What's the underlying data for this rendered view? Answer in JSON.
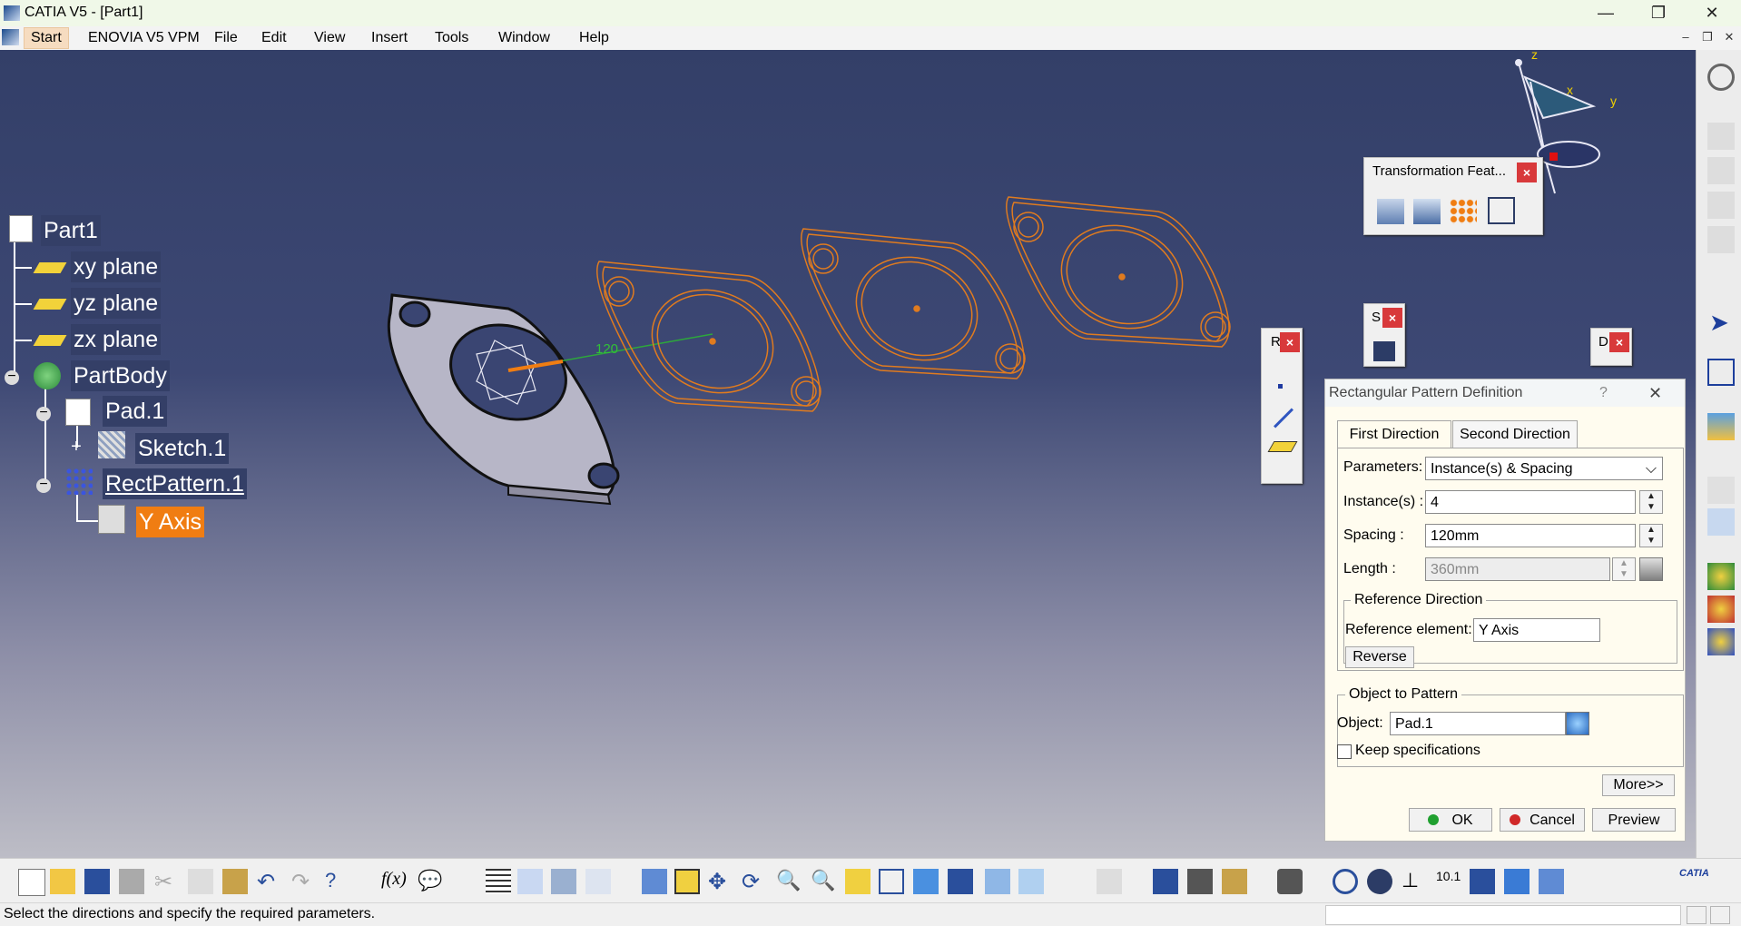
{
  "window": {
    "title": "CATIA V5 - [Part1]",
    "minimize": "—",
    "maximize": "❐",
    "close": "✕"
  },
  "menu": {
    "items": [
      "Start",
      "ENOVIA V5 VPM",
      "File",
      "Edit",
      "View",
      "Insert",
      "Tools",
      "Window",
      "Help"
    ]
  },
  "tree": {
    "root": "Part1",
    "items": [
      "xy plane",
      "yz plane",
      "zx plane",
      "PartBody",
      "Pad.1",
      "Sketch.1",
      "RectPattern.1",
      "Y Axis"
    ]
  },
  "viewport": {
    "dimension_label": "120",
    "compass_axes": [
      "z",
      "x",
      "y"
    ]
  },
  "transformation_toolbar": {
    "title": "Transformation Feat...",
    "close": "×"
  },
  "small_toolbars": [
    {
      "title": "R",
      "close": "×"
    },
    {
      "title": "S",
      "close": "×"
    },
    {
      "title": "D",
      "close": "×"
    }
  ],
  "dialog": {
    "title": "Rectangular Pattern Definition",
    "help": "?",
    "close": "✕",
    "tabs": [
      "First Direction",
      "Second Direction"
    ],
    "parameters_label": "Parameters:",
    "parameters_value": "Instance(s) & Spacing",
    "instances_label": "Instance(s) :",
    "instances_value": "4",
    "spacing_label": "Spacing :",
    "spacing_value": "120mm",
    "length_label": "Length :",
    "length_value": "360mm",
    "ref_group_label": "Reference Direction",
    "ref_element_label": "Reference element:",
    "ref_element_value": "Y Axis",
    "reverse_label": "Reverse",
    "object_group_label": "Object to Pattern",
    "object_label": "Object:",
    "object_value": "Pad.1",
    "keep_spec_label": "Keep specifications",
    "more_label": "More>>",
    "ok_label": "OK",
    "cancel_label": "Cancel",
    "preview_label": "Preview"
  },
  "status": {
    "message": "Select the directions and specify the required parameters."
  },
  "colors": {
    "viewport_top": "#333f68",
    "pattern_orange": "#e07b1f",
    "tree_selected": "#f07d12"
  }
}
